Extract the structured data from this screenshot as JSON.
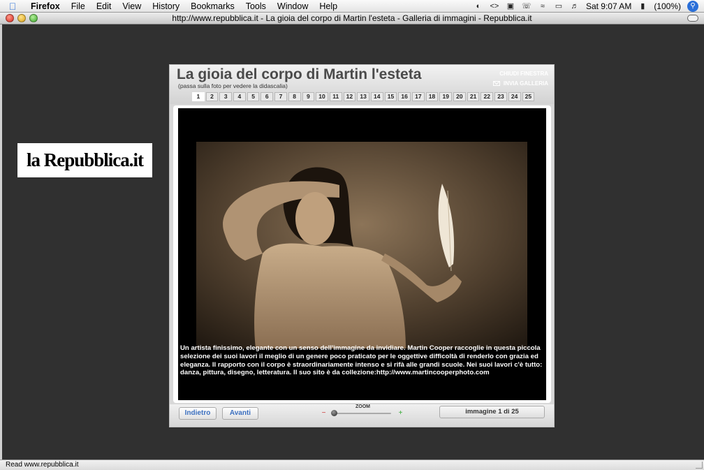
{
  "menubar": {
    "app": "Firefox",
    "items": [
      "File",
      "Edit",
      "View",
      "History",
      "Bookmarks",
      "Tools",
      "Window",
      "Help"
    ],
    "clock": "Sat 9:07 AM",
    "battery": "(100%)"
  },
  "window": {
    "title": "http://www.repubblica.it - La gioia del corpo di Martin l'esteta - Galleria di immagini - Repubblica.it"
  },
  "logo": {
    "text": "la Repubblica.it"
  },
  "gallery": {
    "title": "La gioia del corpo di Martin l'esteta",
    "subtitle": "(passa sulla foto per vedere la didascalia)",
    "close_label": "CHIUDI FINESTRA",
    "send_label": "INVIA GALLERIA",
    "pages": [
      "1",
      "2",
      "3",
      "4",
      "5",
      "6",
      "7",
      "8",
      "9",
      "10",
      "11",
      "12",
      "13",
      "14",
      "15",
      "16",
      "17",
      "18",
      "19",
      "20",
      "21",
      "22",
      "23",
      "24",
      "25"
    ],
    "current_page": "1",
    "caption": "Un artista finissimo, elegante con un senso dell'immagine da invidiare. Martin Cooper raccoglie in questa piccola selezione dei suoi lavori il meglio di un genere poco praticato per le oggettive difficoltà di renderlo con grazia ed eleganza. Il rapporto con il corpo è straordinariamente intenso e si rifà alle grandi scuole. Nei suoi lavori c'è tutto: danza, pittura, disegno, letteratura. Il suo sito è da collezione:http://www.martincooperphoto.com",
    "back_label": "Indietro",
    "next_label": "Avanti",
    "zoom_label": "ZOOM",
    "counter": "immagine 1 di 25"
  },
  "statusbar": {
    "text": "Read www.repubblica.it"
  }
}
